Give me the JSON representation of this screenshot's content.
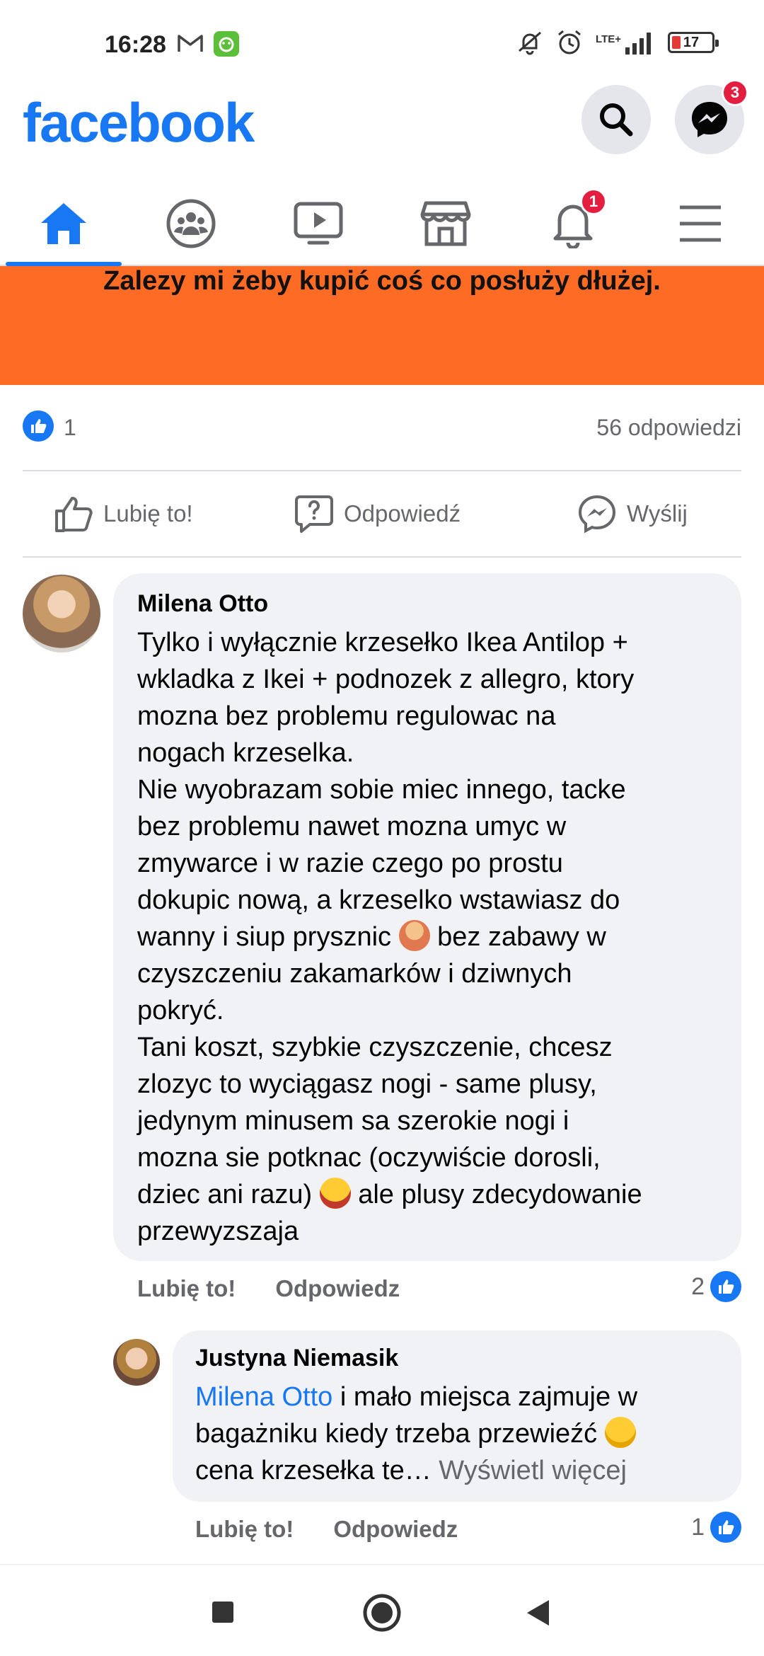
{
  "status_bar": {
    "time": "16:28",
    "network": "LTE+",
    "battery": "17",
    "icons": [
      "gmail-icon",
      "app-icon",
      "mute-icon",
      "alarm-icon",
      "signal-icon",
      "battery-icon"
    ]
  },
  "header": {
    "logo": "facebook",
    "messenger_badge": "3",
    "brand_color": "#1877f2"
  },
  "nav": {
    "tabs": [
      {
        "name": "home",
        "icon": "home-icon",
        "active": true
      },
      {
        "name": "groups",
        "icon": "groups-icon"
      },
      {
        "name": "watch",
        "icon": "video-icon"
      },
      {
        "name": "marketplace",
        "icon": "store-icon"
      },
      {
        "name": "notifications",
        "icon": "bell-icon",
        "badge": "1"
      },
      {
        "name": "menu",
        "icon": "menu-icon"
      }
    ],
    "notifications_badge": "1"
  },
  "post": {
    "banner_text": "Zalezy mi żeby kupić coś co posłuży dłużej.",
    "banner_color": "#fd6b24",
    "like_count": "1",
    "replies": "56 odpowiedzi",
    "actions": {
      "like": "Lubię to!",
      "reply": "Odpowiedź",
      "send": "Wyślij"
    }
  },
  "comments": [
    {
      "author": "Milena Otto",
      "text_1": "Tylko i wyłącznie krzesełko Ikea Antilop +\nwkladka z Ikei + podnozek z allegro, ktory\nmozna bez problemu regulowac na\nnogach krzeselka.\nNie wyobrazam sobie miec innego, tacke\nbez problemu nawet mozna umyc w\nzmywarce i w razie czego po prostu\ndokupic nową, a krzeselko wstawiasz do\nwanny i siup prysznic ",
      "text_2": " bez zabawy w\nczyszczeniu zakamarków i dziwnych\npokryć.\nTani koszt, szybkie czyszczenie, chcesz\nzlozyc to wyciągasz nogi - same plusy,\njedynym minusem sa szerokie nogi i\nmozna sie potknac (oczywiście dorosli,\ndziec ani razu) ",
      "text_3": " ale plusy zdecydowanie\nprzewyzszaja",
      "like_label": "Lubię to!",
      "reply_label": "Odpowiedz",
      "likes": "2"
    },
    {
      "author": "Justyna Niemasik",
      "mention": "Milena Otto",
      "text_1": " i mało miejsca zajmuje w\nbagażniku kiedy trzeba przewieźć ",
      "text_2": "\ncena krzesełka te… ",
      "more": "Wyświetl więcej",
      "like_label": "Lubię to!",
      "reply_label": "Odpowiedz",
      "likes": "1"
    }
  ]
}
